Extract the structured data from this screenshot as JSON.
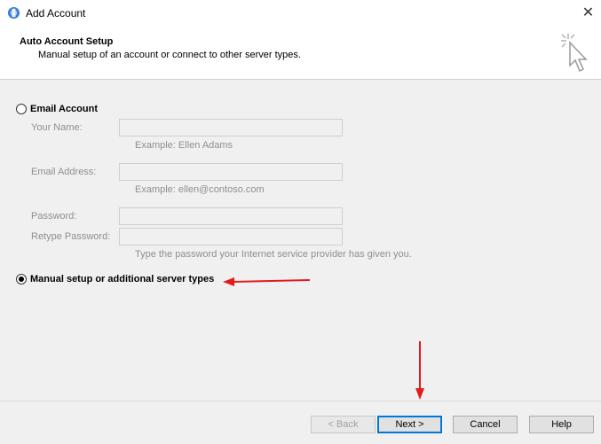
{
  "window": {
    "title": "Add Account"
  },
  "header": {
    "title": "Auto Account Setup",
    "subtitle": "Manual setup of an account or connect to other server types."
  },
  "options": {
    "email_account": {
      "label": "Email Account",
      "selected": false
    },
    "manual_setup": {
      "label": "Manual setup or additional server types",
      "selected": true
    }
  },
  "fields": {
    "your_name": {
      "label": "Your Name:",
      "value": "",
      "hint": "Example: Ellen Adams"
    },
    "email_address": {
      "label": "Email Address:",
      "value": "",
      "hint": "Example: ellen@contoso.com"
    },
    "password": {
      "label": "Password:",
      "value": ""
    },
    "retype_password": {
      "label": "Retype Password:",
      "value": "",
      "hint": "Type the password your Internet service provider has given you."
    }
  },
  "buttons": {
    "back": "< Back",
    "next": "Next >",
    "cancel": "Cancel",
    "help": "Help"
  },
  "annotation_color": "#e21b1b",
  "icons": [
    "app-icon",
    "close-icon",
    "wizard-cursor-icon",
    "red-arrow-left",
    "red-arrow-down"
  ]
}
